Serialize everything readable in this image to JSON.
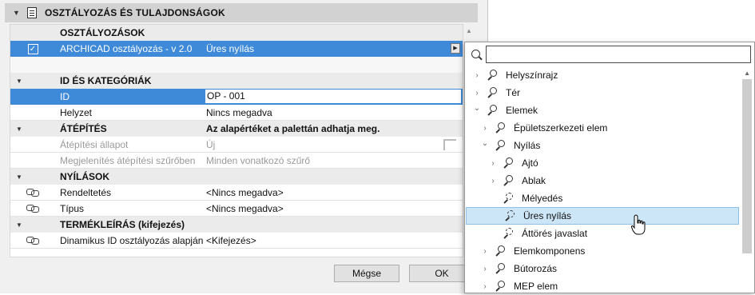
{
  "panel": {
    "title": "OSZTÁLYOZÁS ÉS TULAJDONSÁGOK",
    "sections": {
      "classifications": "OSZTÁLYOZÁSOK",
      "id_categories": "ID ÉS KATEGÓRIÁK",
      "renovation": "ÁTÉPÍTÉS",
      "openings": "NYÍLÁSOK",
      "product": "TERMÉKLEÍRÁS (kifejezés)"
    },
    "rows": {
      "archicad_class": {
        "label": "ARCHICAD osztályozás - v 2.0",
        "value": "Üres nyílás"
      },
      "id": {
        "label": "ID",
        "value": "OP - 001"
      },
      "position": {
        "label": "Helyzet",
        "value": "Nincs megadva"
      },
      "renovation_note": "Az alapértéket a palettán adhatja meg.",
      "reno_status": {
        "label": "Átépítési állapot",
        "value": "Új"
      },
      "reno_filter": {
        "label": "Megjelenítés átépítési szűrőben",
        "value": "Minden vonatkozó szűrő"
      },
      "rendeltetes": {
        "label": "Rendeltetés",
        "value": "<Nincs megadva>"
      },
      "tipus": {
        "label": "Típus",
        "value": "<Nincs megadva>"
      },
      "dynamic_id": {
        "label": "Dinamikus ID osztályozás alapján",
        "value": "<Kifejezés>"
      }
    },
    "buttons": {
      "cancel": "Mégse",
      "ok": "OK"
    }
  },
  "dropdown": {
    "search_placeholder": "",
    "items": [
      {
        "label": "Helyszínrajz",
        "level": 0,
        "chevron": "right",
        "icon": "classification-icon"
      },
      {
        "label": "Tér",
        "level": 0,
        "chevron": "right",
        "icon": "classification-icon"
      },
      {
        "label": "Elemek",
        "level": 0,
        "chevron": "down",
        "icon": "classification-icon"
      },
      {
        "label": "Épületszerkezeti elem",
        "level": 1,
        "chevron": "right",
        "icon": "classification-icon"
      },
      {
        "label": "Nyílás",
        "level": 1,
        "chevron": "down",
        "icon": "classification-icon"
      },
      {
        "label": "Ajtó",
        "level": 2,
        "chevron": "right",
        "icon": "classification-icon"
      },
      {
        "label": "Ablak",
        "level": 2,
        "chevron": "right",
        "icon": "classification-icon"
      },
      {
        "label": "Mélyedés",
        "level": 2,
        "chevron": "none",
        "icon": "classification-leaf-icon"
      },
      {
        "label": "Üres nyílás",
        "level": 2,
        "chevron": "none",
        "icon": "classification-leaf-icon",
        "selected": true
      },
      {
        "label": "Áttörés javaslat",
        "level": 2,
        "chevron": "none",
        "icon": "classification-leaf-icon"
      },
      {
        "label": "Elemkomponens",
        "level": 1,
        "chevron": "right",
        "icon": "classification-icon"
      },
      {
        "label": "Bútorozás",
        "level": 1,
        "chevron": "right",
        "icon": "classification-icon"
      },
      {
        "label": "MEP elem",
        "level": 1,
        "chevron": "right",
        "icon": "classification-icon"
      }
    ]
  },
  "colors": {
    "selection": "#3e8ad8",
    "tree_selection": "#cde6f7"
  }
}
